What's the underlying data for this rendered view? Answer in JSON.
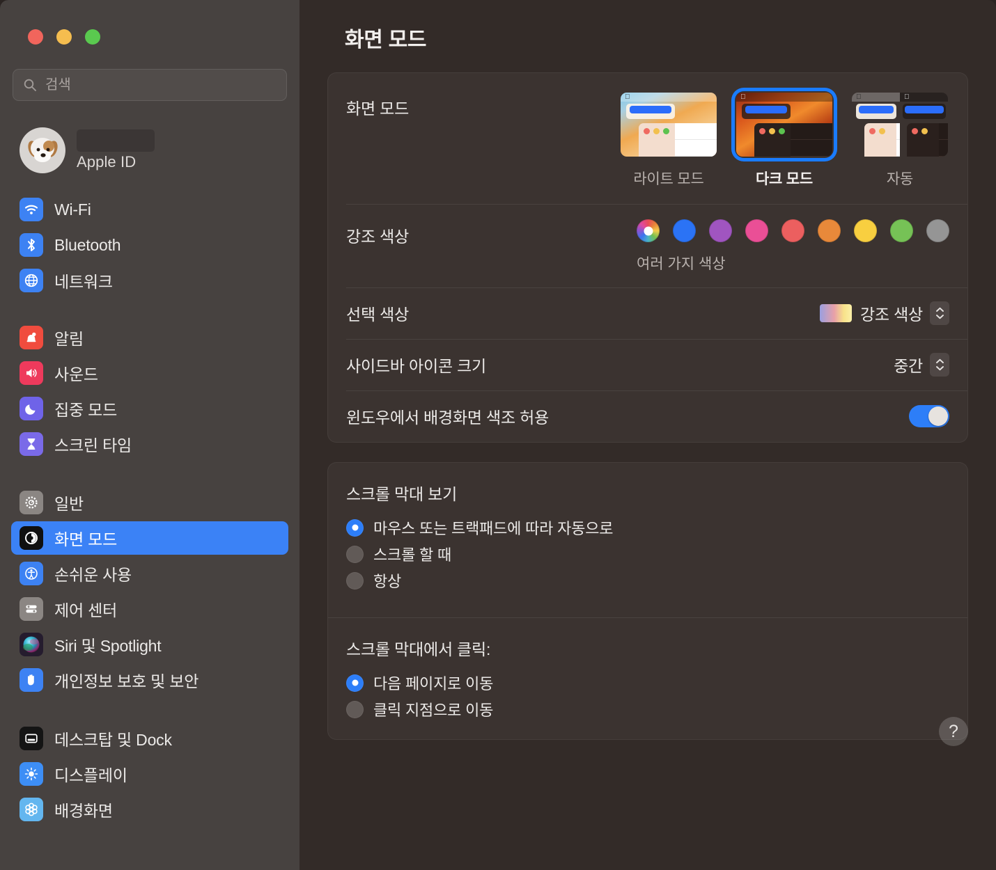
{
  "window": {
    "traffic_lights": [
      {
        "name": "close",
        "color": "#f1655c"
      },
      {
        "name": "minimize",
        "color": "#f5bd4f"
      },
      {
        "name": "maximize",
        "color": "#5ac94f"
      }
    ]
  },
  "sidebar": {
    "search": {
      "placeholder": "검색",
      "value": ""
    },
    "account": {
      "name_redacted": "",
      "subtitle": "Apple ID"
    },
    "groups": [
      {
        "items": [
          {
            "label": "Wi-Fi",
            "icon": "wifi-icon",
            "icon_color": "#3d82f3",
            "selected": false
          },
          {
            "label": "Bluetooth",
            "icon": "bluetooth-icon",
            "icon_color": "#3d82f3",
            "selected": false
          },
          {
            "label": "네트워크",
            "icon": "globe-icon",
            "icon_color": "#3d82f3",
            "selected": false
          }
        ]
      },
      {
        "items": [
          {
            "label": "알림",
            "icon": "bell-icon",
            "icon_color": "#f04c3e",
            "selected": false
          },
          {
            "label": "사운드",
            "icon": "speaker-icon",
            "icon_color": "#ee3a5c",
            "selected": false
          },
          {
            "label": "집중 모드",
            "icon": "moon-icon",
            "icon_color": "#6f63e8",
            "selected": false
          },
          {
            "label": "스크린 타임",
            "icon": "hourglass-icon",
            "icon_color": "#7a6ae8",
            "selected": false
          }
        ]
      },
      {
        "items": [
          {
            "label": "일반",
            "icon": "gear-icon",
            "icon_color": "#8b8683",
            "selected": false
          },
          {
            "label": "화면 모드",
            "icon": "appearance-icon",
            "icon_color": "#111111",
            "selected": true
          },
          {
            "label": "손쉬운 사용",
            "icon": "accessibility-icon",
            "icon_color": "#3d82f3",
            "selected": false
          },
          {
            "label": "제어 센터",
            "icon": "control-center-icon",
            "icon_color": "#8b8683",
            "selected": false
          },
          {
            "label": "Siri 및 Spotlight",
            "icon": "siri-icon",
            "icon_color": "#2a2036",
            "selected": false
          },
          {
            "label": "개인정보 보호 및 보안",
            "icon": "privacy-hand-icon",
            "icon_color": "#3d82f3",
            "selected": false
          }
        ]
      },
      {
        "items": [
          {
            "label": "데스크탑 및 Dock",
            "icon": "desktop-dock-icon",
            "icon_color": "#1c1c1c",
            "selected": false
          },
          {
            "label": "디스플레이",
            "icon": "brightness-icon",
            "icon_color": "#3d8ef5",
            "selected": false
          },
          {
            "label": "배경화면",
            "icon": "wallpaper-icon",
            "icon_color": "#63b6ef",
            "selected": false
          }
        ]
      }
    ]
  },
  "main": {
    "title": "화면 모드",
    "appearance": {
      "label": "화면 모드",
      "modes": [
        {
          "label": "라이트 모드",
          "selected": false
        },
        {
          "label": "다크 모드",
          "selected": true
        },
        {
          "label": "자동",
          "selected": false
        }
      ]
    },
    "accent": {
      "label": "강조 색상",
      "caption": "여러 가지 색상",
      "swatches": [
        {
          "name": "multicolor",
          "color": "multi",
          "selected": true
        },
        {
          "name": "blue",
          "color": "#2b73f5",
          "selected": false
        },
        {
          "name": "purple",
          "color": "#a055c0",
          "selected": false
        },
        {
          "name": "pink",
          "color": "#ea4f96",
          "selected": false
        },
        {
          "name": "red",
          "color": "#ec5f5f",
          "selected": false
        },
        {
          "name": "orange",
          "color": "#e8893a",
          "selected": false
        },
        {
          "name": "yellow",
          "color": "#f8cf40",
          "selected": false
        },
        {
          "name": "green",
          "color": "#76c256",
          "selected": false
        },
        {
          "name": "graphite",
          "color": "#959595",
          "selected": false
        }
      ]
    },
    "highlight": {
      "label": "선택 색상",
      "value": "강조 색상"
    },
    "sidebar_icon_size": {
      "label": "사이드바 아이콘 크기",
      "value": "중간"
    },
    "wallpaper_tint": {
      "label": "윈도우에서 배경화면 색조 허용",
      "enabled": true
    },
    "scrollbar_show": {
      "title": "스크롤 막대 보기",
      "options": [
        {
          "label": "마우스 또는 트랙패드에 따라 자동으로",
          "selected": true
        },
        {
          "label": "스크롤 할 때",
          "selected": false
        },
        {
          "label": "항상",
          "selected": false
        }
      ]
    },
    "scrollbar_click": {
      "title": "스크롤 막대에서 클릭:",
      "options": [
        {
          "label": "다음 페이지로 이동",
          "selected": true
        },
        {
          "label": "클릭 지점으로 이동",
          "selected": false
        }
      ]
    },
    "help": {
      "label": "?"
    }
  }
}
